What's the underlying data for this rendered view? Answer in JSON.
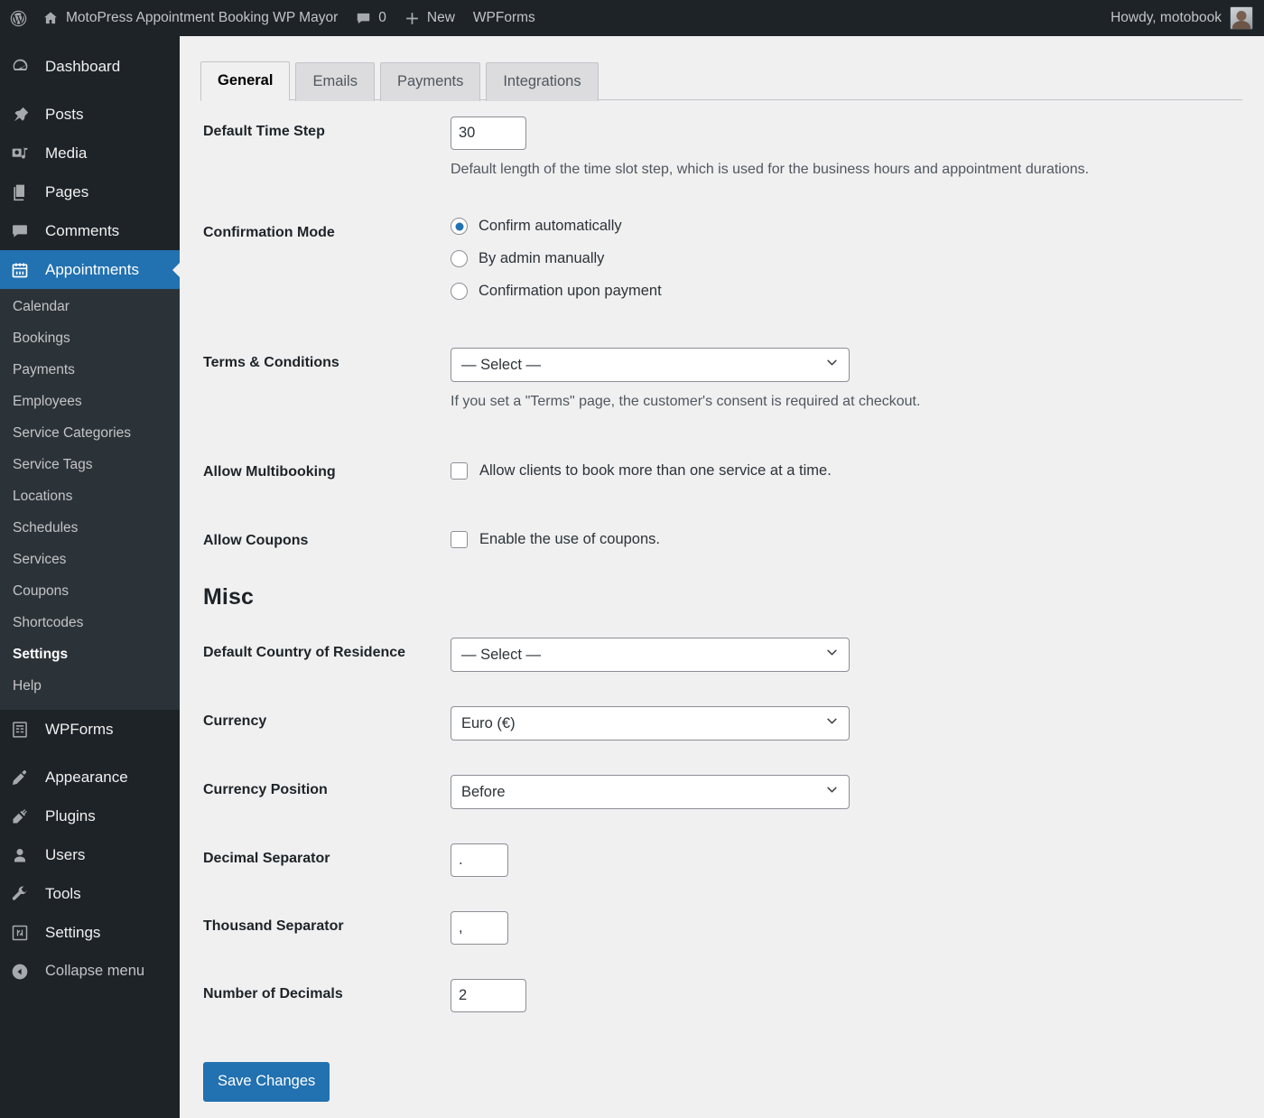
{
  "adminbar": {
    "wp_logo_icon": "wordpress-logo-icon",
    "home_icon": "home-icon",
    "site_title": "MotoPress Appointment Booking WP Mayor",
    "comments_icon": "comment-bubble-icon",
    "comments_count": "0",
    "new_icon": "plus-icon",
    "new_label": "New",
    "wpforms_label": "WPForms",
    "howdy": "Howdy, motobook",
    "avatar_name": "user-avatar"
  },
  "sidebar": {
    "top_items": [
      {
        "label": "Dashboard",
        "icon": "dashboard-icon",
        "current": false
      },
      {
        "label": "Posts",
        "icon": "pin-icon",
        "current": false
      },
      {
        "label": "Media",
        "icon": "media-icon",
        "current": false
      },
      {
        "label": "Pages",
        "icon": "pages-icon",
        "current": false
      },
      {
        "label": "Comments",
        "icon": "comment-bubble-icon",
        "current": false
      },
      {
        "label": "Appointments",
        "icon": "calendar-icon",
        "current": true
      }
    ],
    "submenu": [
      {
        "label": "Calendar",
        "current": false
      },
      {
        "label": "Bookings",
        "current": false
      },
      {
        "label": "Payments",
        "current": false
      },
      {
        "label": "Employees",
        "current": false
      },
      {
        "label": "Service Categories",
        "current": false
      },
      {
        "label": "Service Tags",
        "current": false
      },
      {
        "label": "Locations",
        "current": false
      },
      {
        "label": "Schedules",
        "current": false
      },
      {
        "label": "Services",
        "current": false
      },
      {
        "label": "Coupons",
        "current": false
      },
      {
        "label": "Shortcodes",
        "current": false
      },
      {
        "label": "Settings",
        "current": true
      },
      {
        "label": "Help",
        "current": false
      }
    ],
    "bottom_items": [
      {
        "label": "WPForms",
        "icon": "wpforms-icon"
      },
      {
        "label": "Appearance",
        "icon": "brush-icon"
      },
      {
        "label": "Plugins",
        "icon": "plug-icon"
      },
      {
        "label": "Users",
        "icon": "user-icon"
      },
      {
        "label": "Tools",
        "icon": "wrench-icon"
      },
      {
        "label": "Settings",
        "icon": "settings-icon"
      }
    ],
    "collapse": {
      "label": "Collapse menu",
      "icon": "collapse-arrow-icon"
    }
  },
  "tabs": [
    {
      "label": "General",
      "active": true
    },
    {
      "label": "Emails",
      "active": false
    },
    {
      "label": "Payments",
      "active": false
    },
    {
      "label": "Integrations",
      "active": false
    }
  ],
  "form": {
    "time_step": {
      "label": "Default Time Step",
      "value": "30",
      "description": "Default length of the time slot step, which is used for the business hours and appointment durations."
    },
    "confirmation_mode": {
      "label": "Confirmation Mode",
      "options": [
        {
          "label": "Confirm automatically",
          "checked": true
        },
        {
          "label": "By admin manually",
          "checked": false
        },
        {
          "label": "Confirmation upon payment",
          "checked": false
        }
      ]
    },
    "terms": {
      "label": "Terms & Conditions",
      "value": "— Select —",
      "description": "If you set a \"Terms\" page, the customer's consent is required at checkout."
    },
    "multibooking": {
      "label": "Allow Multibooking",
      "checkbox_label": "Allow clients to book more than one service at a time.",
      "checked": false
    },
    "coupons": {
      "label": "Allow Coupons",
      "checkbox_label": "Enable the use of coupons.",
      "checked": false
    }
  },
  "misc": {
    "heading": "Misc",
    "country": {
      "label": "Default Country of Residence",
      "value": "— Select —"
    },
    "currency": {
      "label": "Currency",
      "value": "Euro (€)"
    },
    "currency_position": {
      "label": "Currency Position",
      "value": "Before"
    },
    "decimal_separator": {
      "label": "Decimal Separator",
      "value": "."
    },
    "thousand_separator": {
      "label": "Thousand Separator",
      "value": ","
    },
    "number_of_decimals": {
      "label": "Number of Decimals",
      "value": "2"
    }
  },
  "save_button": {
    "label": "Save Changes"
  },
  "colors": {
    "accent": "#2271b1",
    "admin_bar_bg": "#1d2327",
    "sidebar_bg": "#1d2327",
    "submenu_bg": "#2c3338",
    "content_bg": "#f0f0f1"
  }
}
